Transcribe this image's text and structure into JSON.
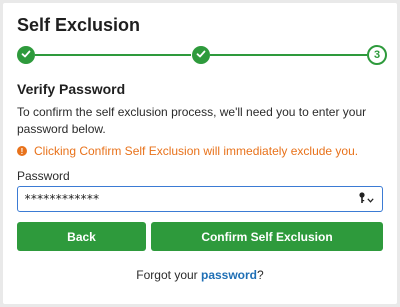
{
  "dialog": {
    "title": "Self Exclusion"
  },
  "stepper": {
    "steps": [
      {
        "state": "done",
        "icon": "check-icon"
      },
      {
        "state": "done",
        "icon": "check-icon"
      },
      {
        "state": "current",
        "label": "3"
      }
    ],
    "accent_color": "#2e9a3c"
  },
  "section": {
    "heading": "Verify Password",
    "description": "To confirm the self exclusion process, we'll need you to enter your password below.",
    "warning": "Clicking Confirm Self Exclusion will immediately exclude you.",
    "warning_icon": "alert-icon",
    "warning_color": "#e8721b"
  },
  "password_field": {
    "label": "Password",
    "value": "************"
  },
  "buttons": {
    "back": "Back",
    "confirm": "Confirm Self Exclusion"
  },
  "forgot": {
    "prefix": "Forgot your ",
    "link": "password",
    "suffix": "?"
  }
}
